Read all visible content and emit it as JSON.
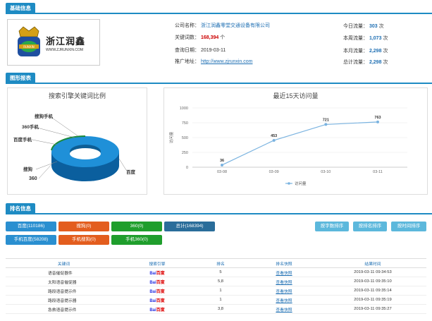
{
  "sections": {
    "basic": "基础信息",
    "charts": "图形报表",
    "rank": "排名信息"
  },
  "logo": {
    "name": "浙江润鑫",
    "url": "WWW.ZJRUNXIN.COM"
  },
  "info": {
    "company_label": "公司名称：",
    "company": "浙江润鑫零堂交通设备有限公司",
    "keywords_label": "关键词数：",
    "keywords": "168,394",
    "keywords_unit": "个",
    "query_label": "查询日期：",
    "query_date": "2019-03-11",
    "promo_label": "推广地址：",
    "promo_url": "http://www.zjrunxin.com"
  },
  "traffic": [
    {
      "label": "今日流量：",
      "value": "303",
      "unit": "次"
    },
    {
      "label": "本周流量：",
      "value": "1,073",
      "unit": "次"
    },
    {
      "label": "本月流量：",
      "value": "2,298",
      "unit": "次"
    },
    {
      "label": "总计流量：",
      "value": "2,298",
      "unit": "次"
    }
  ],
  "pie_title": "搜索引擎关键词比例",
  "pie_labels": [
    "搜狗手机",
    "360手机",
    "百度手机",
    "搜狗",
    "360",
    "百度"
  ],
  "line_title": "最近15天访问量",
  "chart_data": {
    "type": "line",
    "x": [
      "03-08",
      "03-09",
      "03-10",
      "03-11"
    ],
    "series": [
      {
        "name": "访问量",
        "values": [
          36,
          453,
          721,
          763
        ]
      }
    ],
    "ylabel": "访问量",
    "ylim": [
      0,
      1000
    ],
    "yticks": [
      "0",
      "250",
      "500",
      "750",
      "1000"
    ],
    "legend": "bottom",
    "color": "#7ab3e0"
  },
  "buttons_row1": [
    {
      "label": "百度(110186)",
      "color": "blue"
    },
    {
      "label": "搜狗(0)",
      "color": "orange"
    },
    {
      "label": "360(0)",
      "color": "green"
    },
    {
      "label": "总计(168394)",
      "color": "dark"
    }
  ],
  "buttons_row2": [
    {
      "label": "手机百度(58208)",
      "color": "blue"
    },
    {
      "label": "手机搜狗(0)",
      "color": "orange"
    },
    {
      "label": "手机360(0)",
      "color": "green"
    }
  ],
  "sort_buttons": [
    "按字数排序",
    "按排名排序",
    "按时间排序"
  ],
  "table": {
    "headers": [
      "关键词",
      "搜索引擎",
      "排名",
      "排名快照",
      "结果时间"
    ],
    "engine": {
      "bai": "Bai",
      "du": "百度"
    },
    "rows": [
      {
        "kw": "语音催促器件",
        "rank": "5",
        "snap": "查看快照",
        "time": "2019-03-11 09:34:53"
      },
      {
        "kw": "太阳语音催促器",
        "rank": "5,8",
        "snap": "查看快照",
        "time": "2019-03-11 09:35:10"
      },
      {
        "kw": "路段语音提示件",
        "rank": "1",
        "snap": "查看快照",
        "time": "2019-03-11 09:35:14"
      },
      {
        "kw": "路段语音提示器",
        "rank": "1",
        "snap": "查看快照",
        "time": "2019-03-11 09:35:19"
      },
      {
        "kw": "急救语音提示件",
        "rank": "3,8",
        "snap": "查看快照",
        "time": "2019-03-11 09:35:27"
      }
    ]
  }
}
